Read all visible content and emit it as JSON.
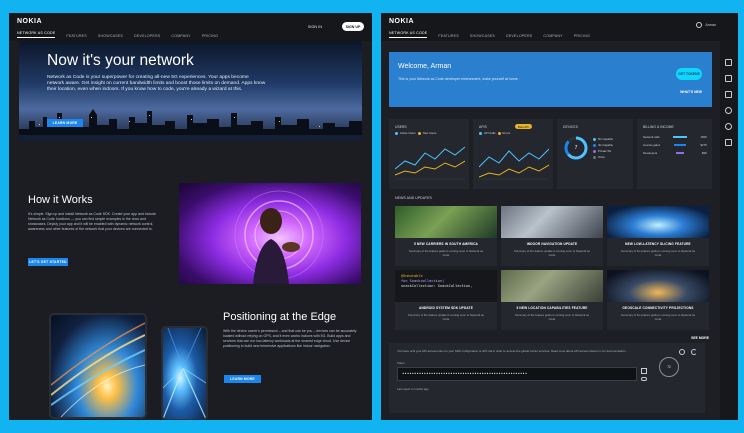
{
  "left": {
    "logo": "NOKIA",
    "nav": [
      "NETWORK AS CODE",
      "FEATURES",
      "SHOWCASES",
      "DEVELOPERS",
      "COMPANY",
      "PRICING"
    ],
    "sign_in": "SIGN IN",
    "sign_up": "SIGN UP",
    "hero": {
      "title": "Now it's your network",
      "description": "Network as Code is your superpower for creating all-new 5G experiences. Your apps become network aware. Get insight on current bandwidth limits and boost those limits on demand. Apps know their location, even when indoors. If you know how to code, you're already a wizard at this.",
      "button": "LEARN MORE"
    },
    "how": {
      "title": "How it Works",
      "text": "It's simple. Sign up and install Network as Code SDK. Create your app and include Network as Code functions — you can find simple examples in the docs and showcases. Deploy your app and it will be enabled with dynamic network control, awareness and other features of the network that your devices are connected to.",
      "button": "LET'S GET STARTED"
    },
    "edge": {
      "title": "Positioning at the Edge",
      "text": "With the device owner's permission – and that can be you – devices can be accurately located without relying on GPS, and it even works indoors with 5G. Build apps and services that can run low-latency workloads at the nearest edge cloud. Use device positioning to build new immersive applications like indoor navigation.",
      "button": "LEARN MORE"
    }
  },
  "right": {
    "logo": "NOKIA",
    "nav": [
      "NETWORK AS CODE",
      "FEATURES",
      "SHOWCASES",
      "DEVELOPERS",
      "COMPANY",
      "PRICING"
    ],
    "user": "Arman",
    "welcome": {
      "title": "Welcome, Arman",
      "text": "This is your Network as Code developer environment, make yourself at home.",
      "token_button": "GET TOKENS",
      "whats_new": "WHAT'S NEW"
    },
    "cards": {
      "users": {
        "title": "USERS",
        "legend": [
          "Active Users",
          "New Users"
        ]
      },
      "apis": {
        "title": "APIS",
        "pill": "Beta API",
        "legend": [
          "API Calls",
          "Errors"
        ]
      },
      "devices": {
        "title": "DEVICES",
        "count": "7",
        "legend": [
          "5G Capable",
          "4G Capable",
          "Private 5G",
          "Other"
        ]
      },
      "billing": {
        "title": "BILLING & INCOME",
        "rows": [
          {
            "label": "Network calls",
            "value": "150K"
          },
          {
            "label": "License gains",
            "value": "$27K"
          },
          {
            "label": "Developers",
            "value": "$9K"
          }
        ]
      }
    },
    "news_head": "NEWS AND UPDATES",
    "news": [
      {
        "title": "5 NEW CARRIERS IN SOUTH AMERICA",
        "sub": "Summary of the feature guide is coming soon to Network as Code"
      },
      {
        "title": "INDOOR NAVIGATION UPDATE",
        "sub": "Summary of the feature update is coming soon to Network as Code"
      },
      {
        "title": "NEW LOW-LATENCY SLICING FEATURE",
        "sub": "Summary of the feature guide is coming soon to Network as Code"
      },
      {
        "title": "ANDROID SYSTEM SDK UPDATE",
        "sub": "Summary of the feature update is coming soon to Network as Code"
      },
      {
        "title": "5 NEW LOCATION CAPABILITIES FEATURE",
        "sub": "Summary of the feature guide is coming soon to Network as Code"
      },
      {
        "title": "GEOSCALE CONNECTIVITY PROJECTIONS",
        "sub": "Summary of the feature guide is coming soon to Network as Code"
      }
    ],
    "see_more": "SEE MORE",
    "code_lines": [
      "@Unmutable",
      "fun Snackcollection(",
      "  snackCollection: SnackCollection,"
    ],
    "access": {
      "head": "ACCESS TOKENS",
      "text": "You have until your API access token to your SDK configuration or API call in order to access the global carrier services. Read more about API access tokens in our documentation.",
      "label": "Token",
      "value": "••••••••••••••••••••••••••••••••••••••••••••••••••••",
      "footer": "Last used: 2 months ago",
      "timer": "72"
    }
  }
}
